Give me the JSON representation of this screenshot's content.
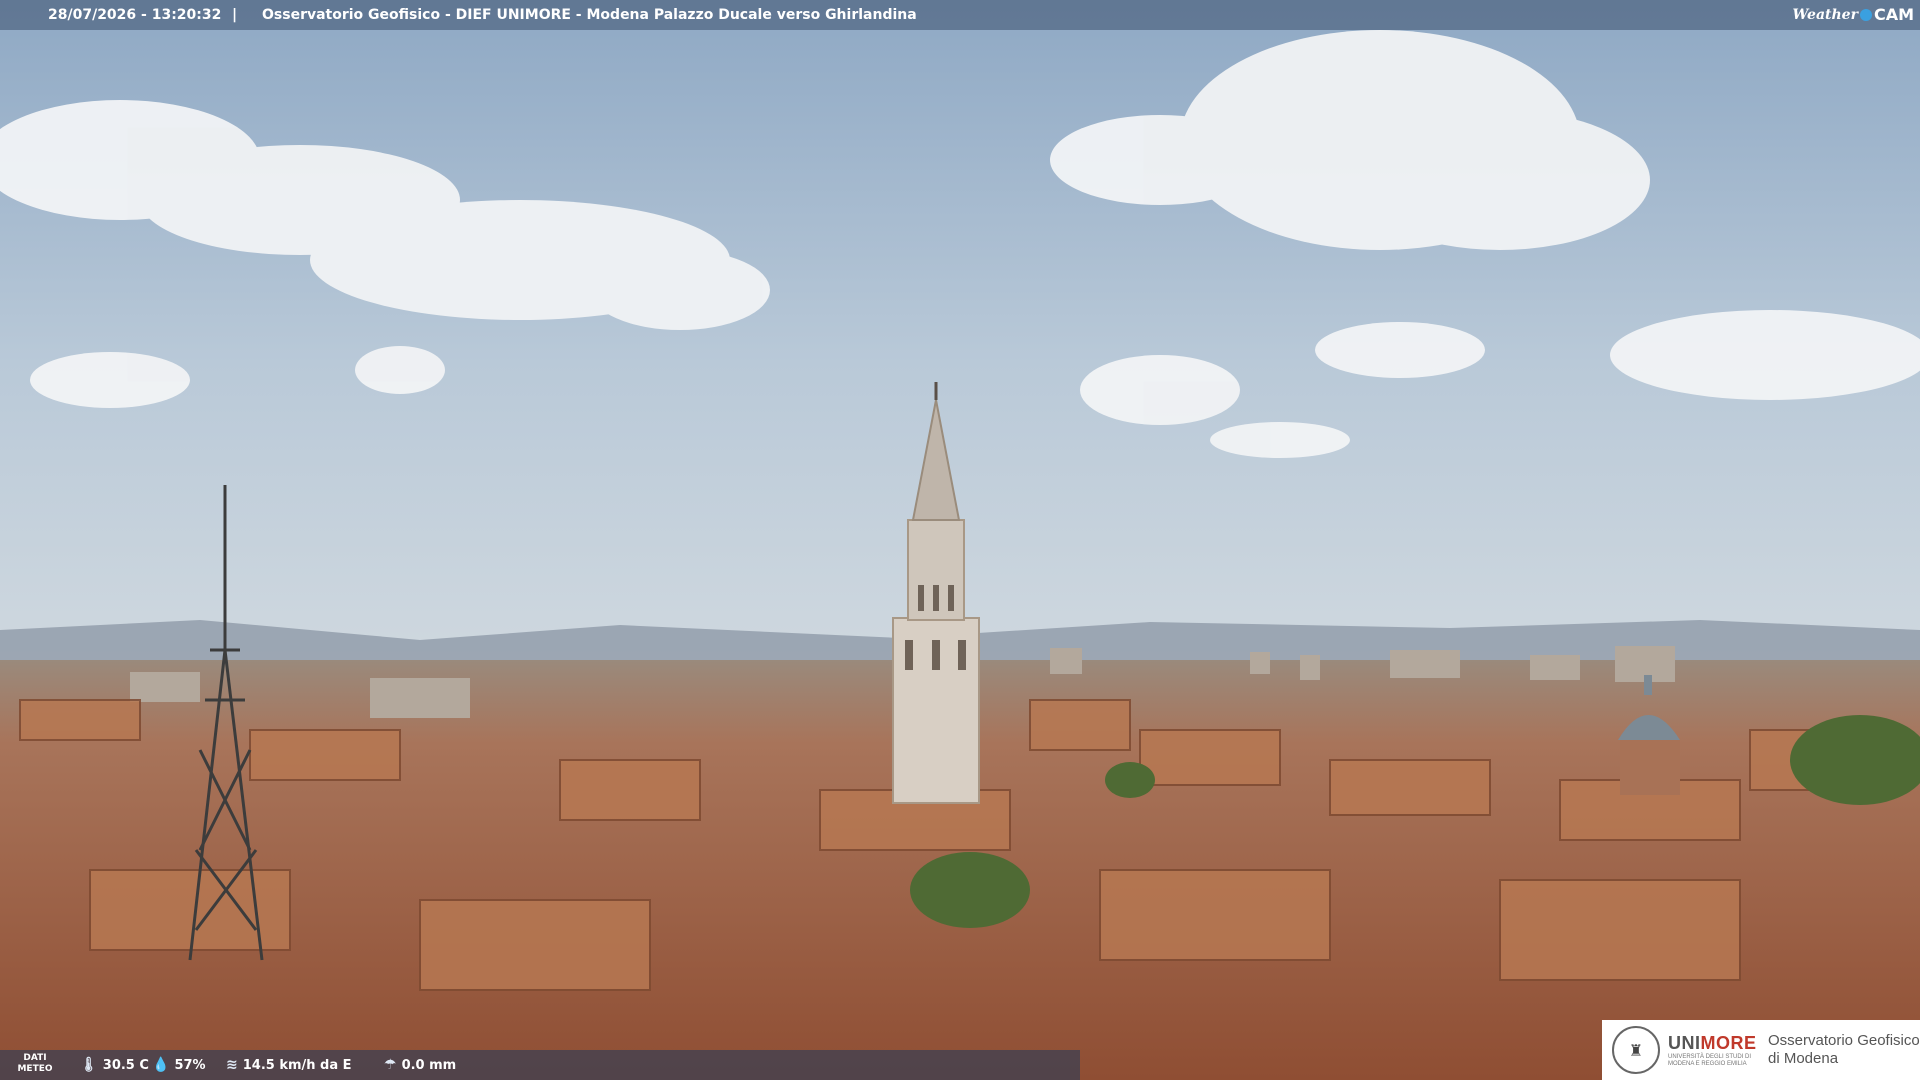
{
  "overlay": {
    "datetime": "28/07/2026 - 13:20:32",
    "separator": "|",
    "camera_title": "Osservatorio Geofisico - DIEF UNIMORE - Modena Palazzo Ducale verso Ghirlandina",
    "brand_part1": "Weather",
    "brand_part2": "CAM"
  },
  "weather": {
    "label": "DATI METEO",
    "temperature": "30.5 C",
    "humidity": "57%",
    "wind": "14.5 km/h da E",
    "rain": "0.0 mm",
    "icons": [
      "thermometer-icon",
      "humidity-icon",
      "wind-icon",
      "rain-gauge-icon"
    ]
  },
  "logo": {
    "uni_prefix": "UNI",
    "uni_suffix": "MORE",
    "uni_small": "UNIVERSITÀ DEGLI STUDI DI MODENA E REGGIO EMILIA",
    "observatory_line1": "Osservatorio Geofisico",
    "observatory_line2": "di Modena"
  },
  "colors": {
    "sky": "#a9bfd3",
    "roofs": "#b4704a",
    "unimore_red": "#c0392b"
  }
}
